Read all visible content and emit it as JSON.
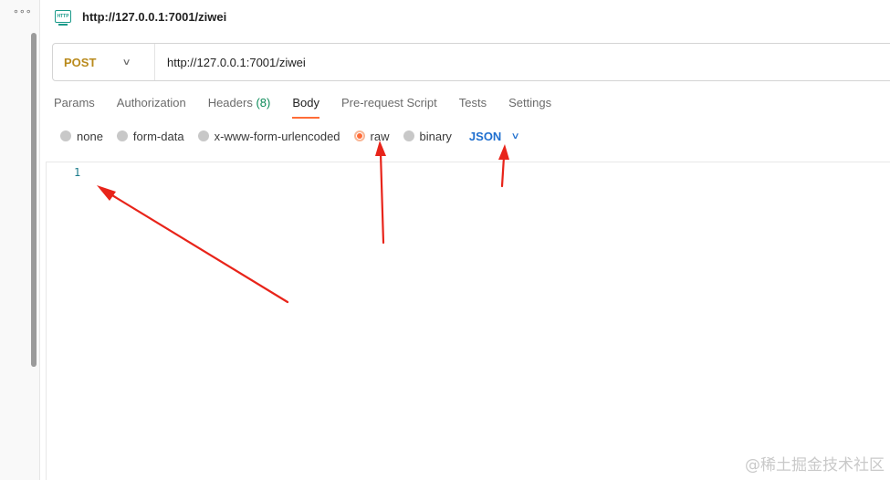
{
  "sidebar": {
    "more_icon": "more-horizontal-icon"
  },
  "request": {
    "icon": "http-icon",
    "icon_text": "HTTP",
    "title": "http://127.0.0.1:7001/ziwei",
    "method": "POST",
    "url": "http://127.0.0.1:7001/ziwei"
  },
  "tabs": [
    {
      "label": "Params"
    },
    {
      "label": "Authorization"
    },
    {
      "label": "Headers",
      "count": "(8)"
    },
    {
      "label": "Body",
      "active": true
    },
    {
      "label": "Pre-request Script"
    },
    {
      "label": "Tests"
    },
    {
      "label": "Settings"
    }
  ],
  "body_types": {
    "options": [
      "none",
      "form-data",
      "x-www-form-urlencoded",
      "raw",
      "binary"
    ],
    "selected": "raw",
    "format": "JSON"
  },
  "editor": {
    "line_number": "1"
  },
  "watermark": "@稀土掘金技术社区",
  "colors": {
    "accent": "#ff6c37",
    "method": "#b98a1c",
    "json": "#1f6fcf",
    "annotation": "#e8241a"
  }
}
